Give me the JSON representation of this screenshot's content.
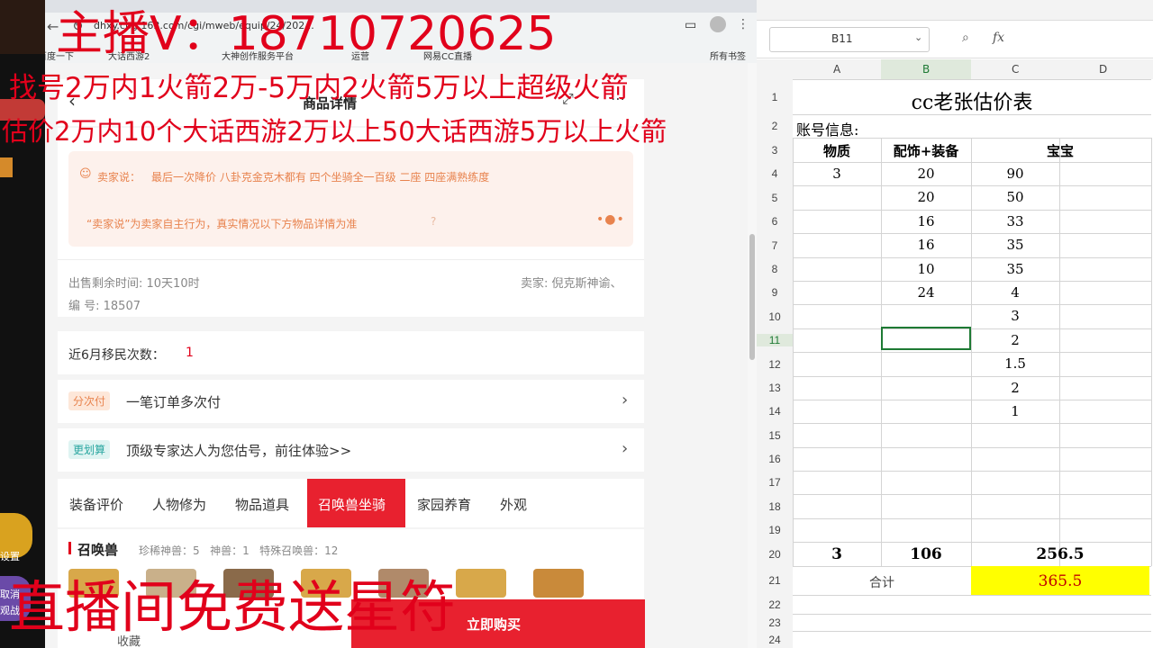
{
  "browser": {
    "url": "dhxy.cbg.163.com/cgi/mweb/equip/24/202...",
    "bookmarks": [
      "百度一下",
      "大话西游2",
      "大神创作服务平台",
      "运营",
      "网易CC直播",
      "所有书签"
    ],
    "page_title": "商品详情",
    "seller_says_prefix": "卖家说：",
    "seller_says": "最后一次降价 八卦克金克木都有 四个坐骑全一百级 二座 四座满熟练度",
    "seller_disclaimer": "“卖家说”为卖家自主行为，真实情况以下方物品详情为准",
    "time_left": "出售剩余时间: 10天10时",
    "seller": "卖家: 倪克斯神谕、",
    "serial": "编 号: 18507",
    "migrate_label": "近6月移民次数：",
    "migrate_count": "1",
    "installment_badge": "分次付",
    "installment_text": "一笔订单多次付",
    "compare_badge": "更划算",
    "compare_text": "顶级专家达人为您估号，前往体验>>",
    "tabs": [
      "装备评价",
      "人物修为",
      "物品道具",
      "召唤兽坐骑",
      "家园养育",
      "外观"
    ],
    "active_tab": "召唤兽坐骑",
    "pet_section_title": "召唤兽",
    "pet_stats": "珍稀神兽：5   神兽：1   特殊召唤兽：12",
    "collect_label": "收藏",
    "buy_label": "立即购买"
  },
  "sheet": {
    "name_box": "B11",
    "fx_label": "fx",
    "col_headers": [
      "A",
      "B",
      "C",
      "D"
    ],
    "title": "cc老张估价表",
    "account_label": "账号信息:",
    "headers": [
      "物质",
      "配饰+装备",
      "宝宝"
    ],
    "rows": [
      [
        "3",
        "20",
        "90"
      ],
      [
        "",
        "20",
        "50"
      ],
      [
        "",
        "16",
        "33"
      ],
      [
        "",
        "16",
        "35"
      ],
      [
        "",
        "10",
        "35"
      ],
      [
        "",
        "24",
        "4"
      ],
      [
        "",
        "",
        "3"
      ],
      [
        "",
        "",
        "2"
      ],
      [
        "",
        "",
        "1.5"
      ],
      [
        "",
        "",
        "2"
      ],
      [
        "",
        "",
        "1"
      ]
    ],
    "totals": [
      "3",
      "106",
      "256.5"
    ],
    "sum_label": "合计",
    "sum_value": "365.5",
    "highlight_color": "#ffff00",
    "sum_text_color": "#c00000",
    "row_numbers": [
      "1",
      "2",
      "3",
      "4",
      "5",
      "6",
      "7",
      "8",
      "9",
      "10",
      "11",
      "12",
      "13",
      "14",
      "15",
      "16",
      "17",
      "18",
      "19",
      "20",
      "21",
      "22",
      "23",
      "24"
    ]
  },
  "overlay": {
    "line1": "主播V：18710720625",
    "line2": "找号2万内1火箭2万-5万内2火箭5万以上超级火箭",
    "line3": "估价2万内10个大话西游2万以上50大话西游5万以上火箭",
    "line4": "直播间免费送星符",
    "color": "#e1001b"
  },
  "game_strip": {
    "settings_label": "设置",
    "label_2": "取消",
    "label_3": "观战"
  }
}
